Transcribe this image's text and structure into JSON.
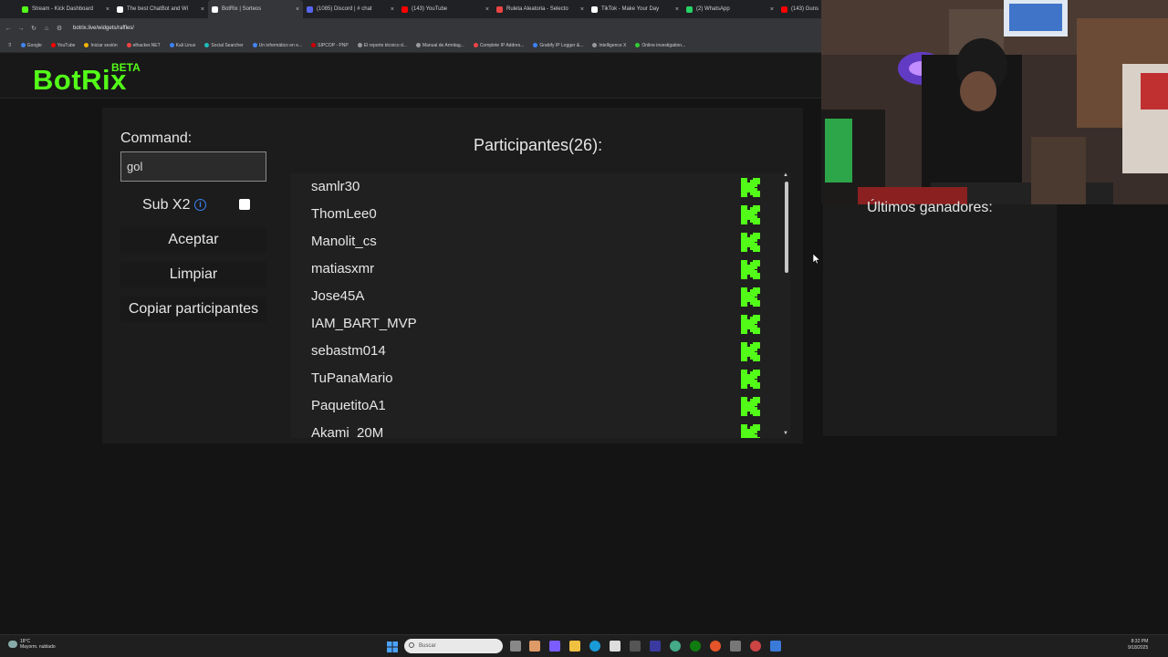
{
  "browser": {
    "tabs": [
      {
        "title": "Stream - Kick Dashboard",
        "color": "#53fc18",
        "active": false
      },
      {
        "title": "The best ChatBot and Wi",
        "color": "#ffffff",
        "active": false
      },
      {
        "title": "BotRix | Sorteos",
        "color": "#ffffff",
        "active": true
      },
      {
        "title": "(1085) Discord | # chat",
        "color": "#5865f2",
        "active": false
      },
      {
        "title": "(143) YouTube",
        "color": "#ff0000",
        "active": false
      },
      {
        "title": "Ruleta Aleatoria - Selecto",
        "color": "#e44",
        "active": false
      },
      {
        "title": "TikTok - Make Your Day",
        "color": "#ffffff",
        "active": false
      },
      {
        "title": "(2) WhatsApp",
        "color": "#25d366",
        "active": false
      },
      {
        "title": "(143) Guns",
        "color": "#ff0000",
        "active": false
      }
    ],
    "url": "botrix.live/widgets/raffles/",
    "bookmarks": [
      {
        "label": "Google",
        "color": "#4285f4"
      },
      {
        "label": "YouTube",
        "color": "#ff0000"
      },
      {
        "label": "Iniciar sesión",
        "color": "#f4b400"
      },
      {
        "label": "elhacker.NET",
        "color": "#e44"
      },
      {
        "label": "Kali Linux",
        "color": "#3b82f6"
      },
      {
        "label": "Social Searcher",
        "color": "#2bb"
      },
      {
        "label": "Un informático en e...",
        "color": "#4285f4"
      },
      {
        "label": "SIPCOP - PNP",
        "color": "#c00"
      },
      {
        "label": "El reporte técnico d...",
        "color": "#999"
      },
      {
        "label": "Manual de Armitag...",
        "color": "#999"
      },
      {
        "label": "Complete IP Addres...",
        "color": "#e44"
      },
      {
        "label": "Grabify IP Logger &...",
        "color": "#3b82f6"
      },
      {
        "label": "Intelligence X",
        "color": "#999"
      },
      {
        "label": "Online investigation...",
        "color": "#3c3"
      }
    ]
  },
  "app": {
    "logo": "BotRix",
    "beta": "BETA"
  },
  "raffle": {
    "command_label": "Command:",
    "command_value": "gol",
    "sub_label": "Sub X2",
    "sub_checked": false,
    "accept_label": "Aceptar",
    "clear_label": "Limpiar",
    "copy_label": "Copiar participantes",
    "participants_title": "Participantes(26):",
    "participants": [
      "samlr30",
      "ThomLee0",
      "Manolit_cs",
      "matiasxmr",
      "Jose45A",
      "IAM_BART_MVP",
      "sebastm014",
      "TuPanaMario",
      "PaquetitoA1",
      "Akami_20M"
    ],
    "winners_title": "Últimos ganadores:"
  },
  "taskbar": {
    "weather_temp": "18°C",
    "weather_desc": "Mayorm. nublado",
    "search_placeholder": "Buscar",
    "time": "8:32 PM",
    "date": "9/18/2025"
  }
}
